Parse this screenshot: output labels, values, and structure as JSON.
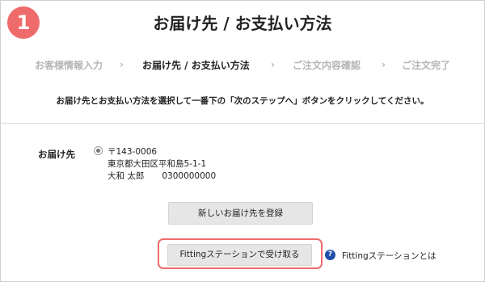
{
  "step_badge": "1",
  "page_title": "お届け先 / お支払い方法",
  "progress": {
    "steps": [
      "お客様情報入力",
      "お届け先 / お支払い方法",
      "ご注文内容確認",
      "ご注文完了"
    ],
    "active_index": 1,
    "separator": "›"
  },
  "instruction": "お届け先とお支払い方法を選択して一番下の「次のステップへ」ボタンをクリックしてください。",
  "address": {
    "label": "お届け先",
    "postal": "〒143-0006",
    "street": "東京都大田区平和島5-1-1",
    "name": "大和 太郎",
    "phone": "0300000000"
  },
  "buttons": {
    "new_address": "新しいお届け先を登録",
    "fitting_pickup": "Fittingステーションで受け取る"
  },
  "help": {
    "icon": "?",
    "link": "Fittingステーションとは"
  },
  "colors": {
    "accent": "#ef6b6b",
    "help_icon": "#1f4fa8"
  }
}
